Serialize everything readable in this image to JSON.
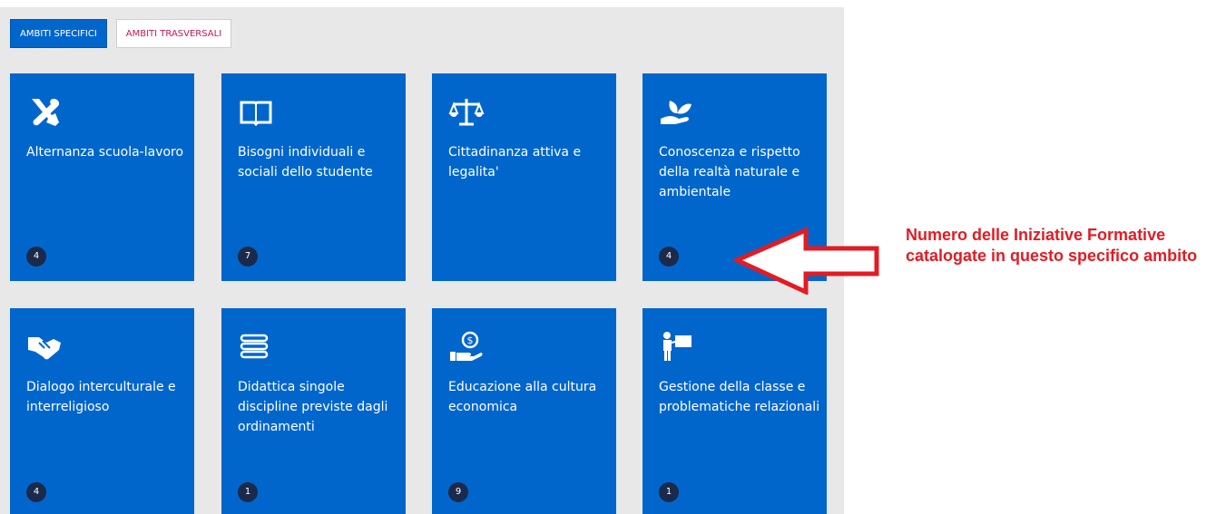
{
  "tabs": {
    "specifici": "AMBITI SPECIFICI",
    "trasversali": "AMBITI TRASVERSALI"
  },
  "cards": [
    {
      "title": "Alternanza scuola-lavoro",
      "count": "4",
      "icon": "tools-icon"
    },
    {
      "title": "Bisogni individuali e sociali dello studente",
      "count": "7",
      "icon": "book-icon"
    },
    {
      "title": "Cittadinanza attiva e legalita'",
      "count": "",
      "icon": "scales-icon"
    },
    {
      "title": "Conoscenza e rispetto della realtà naturale e ambientale",
      "count": "4",
      "icon": "hand-plant-icon"
    },
    {
      "title": "Dialogo interculturale e interreligioso",
      "count": "4",
      "icon": "handshake-icon"
    },
    {
      "title": "Didattica singole discipline previste dagli ordinamenti",
      "count": "1",
      "icon": "stack-icon"
    },
    {
      "title": "Educazione alla cultura economica",
      "count": "9",
      "icon": "money-hand-icon"
    },
    {
      "title": "Gestione della classe e problematiche relazionali",
      "count": "1",
      "icon": "teacher-board-icon"
    }
  ],
  "annotation": "Numero delle Iniziative Formative catalogate in questo specifico ambito",
  "colors": {
    "card": "#0066cc",
    "badge": "#1b2a4a",
    "annotation": "#e31b23",
    "tab_inactive_text": "#c2185b"
  }
}
